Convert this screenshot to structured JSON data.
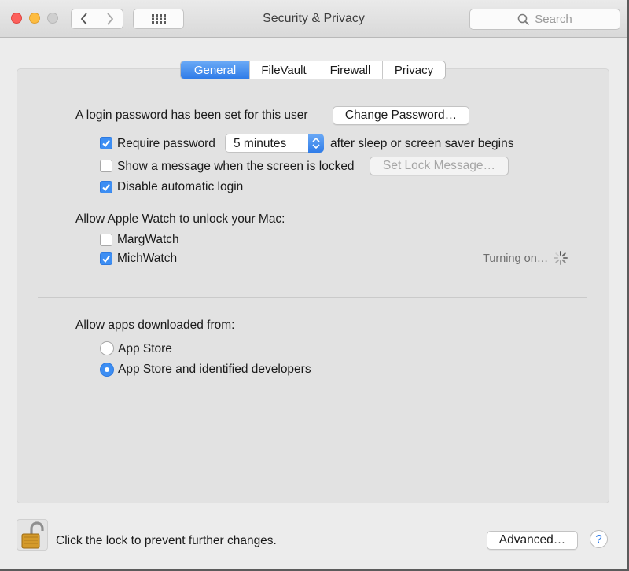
{
  "window": {
    "title": "Security & Privacy",
    "search_placeholder": "Search"
  },
  "tabs": [
    {
      "label": "General",
      "active": true
    },
    {
      "label": "FileVault",
      "active": false
    },
    {
      "label": "Firewall",
      "active": false
    },
    {
      "label": "Privacy",
      "active": false
    }
  ],
  "general": {
    "login_text": "A login password has been set for this user",
    "change_password_label": "Change Password…",
    "require_password": {
      "label": "Require password",
      "checked": true
    },
    "require_password_interval": "5 minutes",
    "after_sleep_text": "after sleep or screen saver begins",
    "show_message": {
      "label": "Show a message when the screen is locked",
      "checked": false
    },
    "set_lock_message_label": "Set Lock Message…",
    "disable_auto_login": {
      "label": "Disable automatic login",
      "checked": true
    }
  },
  "apple_watch": {
    "heading": "Allow Apple Watch to unlock your Mac:",
    "watches": [
      {
        "label": "MargWatch",
        "checked": false
      },
      {
        "label": "MichWatch",
        "checked": true
      }
    ],
    "status_text": "Turning on…"
  },
  "downloads": {
    "heading": "Allow apps downloaded from:",
    "options": [
      {
        "label": "App Store",
        "selected": false
      },
      {
        "label": "App Store and identified developers",
        "selected": true
      }
    ]
  },
  "footer": {
    "lock_text": "Click the lock to prevent further changes.",
    "advanced_label": "Advanced…",
    "help_label": "?"
  },
  "colors": {
    "accent": "#3d8ef3",
    "close": "#fc605c",
    "minimize": "#fdbc40"
  }
}
